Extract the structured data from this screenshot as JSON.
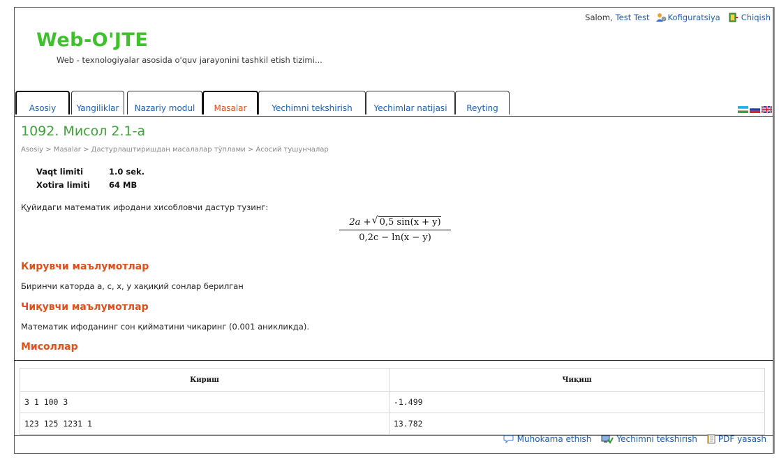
{
  "header": {
    "greeting": "Salom,",
    "user": "Test Test",
    "settings": "Kofiguratsiya",
    "logout": "Chiqish"
  },
  "brand": {
    "logo": "Web-O'JTE",
    "tagline": "Web - texnologiyalar asosida o'quv jarayonini tashkil etish tizimi..."
  },
  "tabs": [
    {
      "label": "Asosiy"
    },
    {
      "label": "Yangiliklar"
    },
    {
      "label": "Nazariy modul"
    },
    {
      "label": "Masalar"
    },
    {
      "label": "Yechimni tekshirish"
    },
    {
      "label": "Yechimlar natijasi"
    },
    {
      "label": "Reyting"
    }
  ],
  "problem": {
    "title": "1092. Мисол 2.1-а",
    "breadcrumb": "Asosiy > Masalar > Дастурлаштиришдан масалалар тўплами > Асосий тушунчалар",
    "time_label": "Vaqt limiti",
    "time_value": "1.0 sek.",
    "mem_label": "Xotira limiti",
    "mem_value": "64 MB",
    "statement": "Қуйидаги математик ифодани хисобловчи дастур тузинг:",
    "input_heading": "Кирувчи маълумотлар",
    "input_text": "Биринчи каторда а, с, х, у хақиқий сонлар берилган",
    "output_heading": "Чиқувчи маълумотлар",
    "output_text": "Математик ифоданинг сон қийматини чикаринг (0.001 аникликда).",
    "examples_heading": "Мисоллар"
  },
  "formula": {
    "num_a": "2a",
    "plus": "+",
    "sqrt_body": "0,5 sin(x + y)",
    "den": "0,2c − ln(x − y)"
  },
  "examples": {
    "headers": [
      "Кириш",
      "Чиқиш"
    ],
    "rows": [
      [
        "3 1 100 3",
        "-1.499"
      ],
      [
        "123 125 1231 1",
        "13.782"
      ]
    ]
  },
  "actions": {
    "discuss": "Muhokama ethish",
    "check": "Yechimni tekshirish",
    "pdf": "PDF yasash"
  },
  "colors": {
    "brand_green": "#3ec12c",
    "title_green": "#3ea13a",
    "accent_orange": "#e0501b",
    "link_blue": "#1a5fb4"
  },
  "icons": [
    "user-settings-icon",
    "exit-door-icon",
    "flag-uz-icon",
    "flag-ru-icon",
    "flag-uk-icon",
    "comment-icon",
    "computer-check-icon",
    "pdf-document-icon"
  ]
}
